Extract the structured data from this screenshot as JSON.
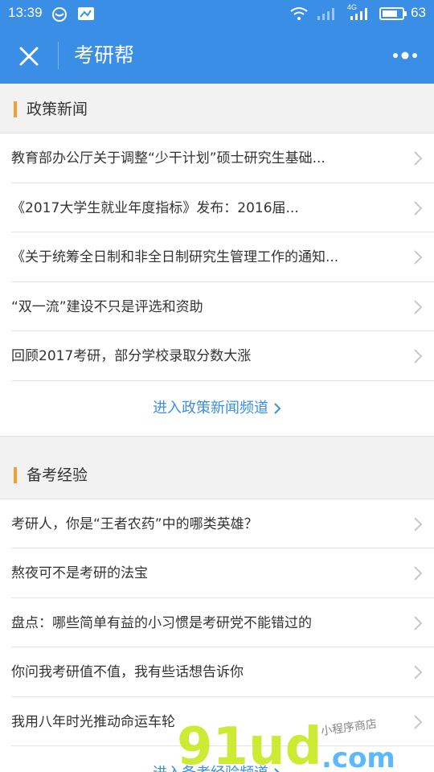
{
  "status": {
    "time": "13:39",
    "battery": "63",
    "network": "4G",
    "icons": [
      "chat-bubble-icon",
      "mail-icon",
      "wifi-icon",
      "signal-icon",
      "battery-icon"
    ]
  },
  "navbar": {
    "title": "考研帮",
    "close_icon": "close-icon",
    "more_icon": "more-dots-icon"
  },
  "policy": {
    "title": "政策新闻",
    "items": [
      {
        "text": "教育部办公厅关于调整“少干计划”硕士研究生基础..."
      },
      {
        "text": "《2017大学生就业年度指标》发布：2016届..."
      },
      {
        "text": "《关于统筹全日制和非全日制研究生管理工作的通知..."
      },
      {
        "text": "“双一流”建设不只是评选和资助"
      },
      {
        "text": "回顾2017考研，部分学校录取分数大涨"
      }
    ],
    "more_label": "进入政策新闻频道"
  },
  "prep": {
    "title": "备考经验",
    "items": [
      {
        "text": "考研人，你是“王者农药”中的哪类英雄？"
      },
      {
        "text": "熬夜可不是考研的法宝"
      },
      {
        "text": "盘点：哪些简单有益的小习惯是考研党不能错过的"
      },
      {
        "text": "你问我考研值不值，我有些话想告诉你"
      },
      {
        "text": "我用八年时光推动命运车轮"
      }
    ],
    "more_label": "进入备考经验频道"
  },
  "watermark": {
    "brand": "91ud",
    "suffix": ".com",
    "tagline": "小程序商店"
  },
  "colors": {
    "accent": "#3a8ee6",
    "section_bar": "#f0a030"
  }
}
